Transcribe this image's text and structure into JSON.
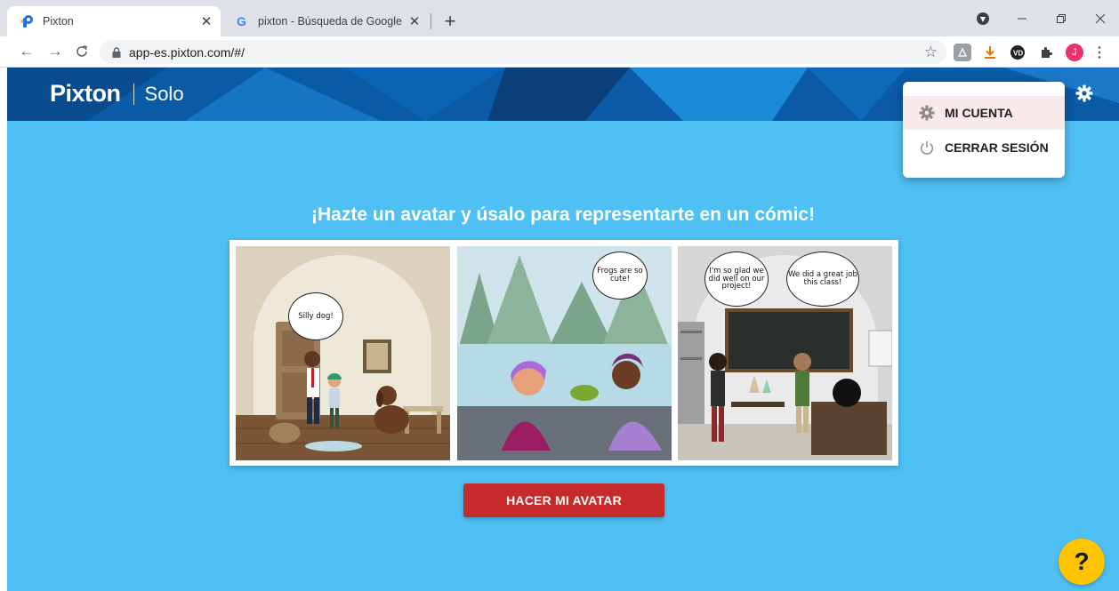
{
  "browser": {
    "tabs": [
      {
        "title": "Pixton",
        "favicon": "pixton-favicon",
        "active": true
      },
      {
        "title": "pixton - Búsqueda de Google",
        "favicon": "google-favicon",
        "active": false
      }
    ],
    "url": "app-es.pixton.com/#/",
    "profile_initial": "J"
  },
  "header": {
    "brand": "Pixton",
    "mode": "Solo"
  },
  "main": {
    "headline": "¡Hazte un avatar y úsalo para representarte en un cómic!",
    "cta_label": "HACER MI AVATAR",
    "help_label": "?"
  },
  "comic": {
    "panel1": {
      "bubble": "Silly dog!"
    },
    "panel2": {
      "bubble": "Frogs are so cute!"
    },
    "panel3": {
      "bubble_left": "I'm so glad we did well on our project!",
      "bubble_right": "We did a great job this class!"
    }
  },
  "menu": {
    "items": [
      {
        "label": "MI CUENTA",
        "icon": "gear-icon",
        "highlighted": true
      },
      {
        "label": "CERRAR SESIÓN",
        "icon": "power-icon",
        "highlighted": false
      }
    ]
  },
  "colors": {
    "page_bg": "#4fc0f3",
    "banner": "#0a5aa6",
    "cta": "#c62a2a",
    "help": "#ffc400",
    "menu_highlight": "#f8e9ea"
  }
}
